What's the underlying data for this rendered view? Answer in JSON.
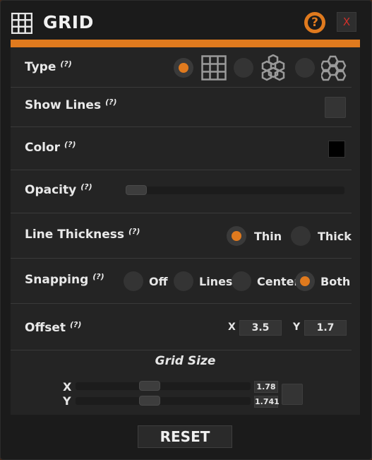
{
  "window": {
    "title": "GRID",
    "help_label": "?",
    "close_label": "X",
    "accent_color": "#e07a1e"
  },
  "rows": {
    "type": {
      "label": "Type",
      "help": "(?)",
      "options": [
        "square-grid",
        "hex-grid-vertical",
        "hex-grid-horizontal"
      ],
      "selected": "square-grid"
    },
    "show_lines": {
      "label": "Show Lines",
      "help": "(?)",
      "checked": false
    },
    "color": {
      "label": "Color",
      "help": "(?)",
      "value": "#000000"
    },
    "opacity": {
      "label": "Opacity",
      "help": "(?)",
      "value": 0
    },
    "line_thickness": {
      "label": "Line Thickness",
      "help": "(?)",
      "options": [
        "Thin",
        "Thick"
      ],
      "selected": "Thin"
    },
    "snapping": {
      "label": "Snapping",
      "help": "(?)",
      "options": [
        "Off",
        "Lines",
        "Center",
        "Both"
      ],
      "selected": "Both"
    },
    "offset": {
      "label": "Offset",
      "help": "(?)",
      "x_label": "X",
      "x_value": "3.5",
      "y_label": "Y",
      "y_value": "1.7"
    }
  },
  "grid_size": {
    "title": "Grid Size",
    "x_label": "X",
    "x_value": "1.78",
    "y_label": "Y",
    "y_value": "1.741",
    "link_checked": false
  },
  "reset_label": "RESET"
}
